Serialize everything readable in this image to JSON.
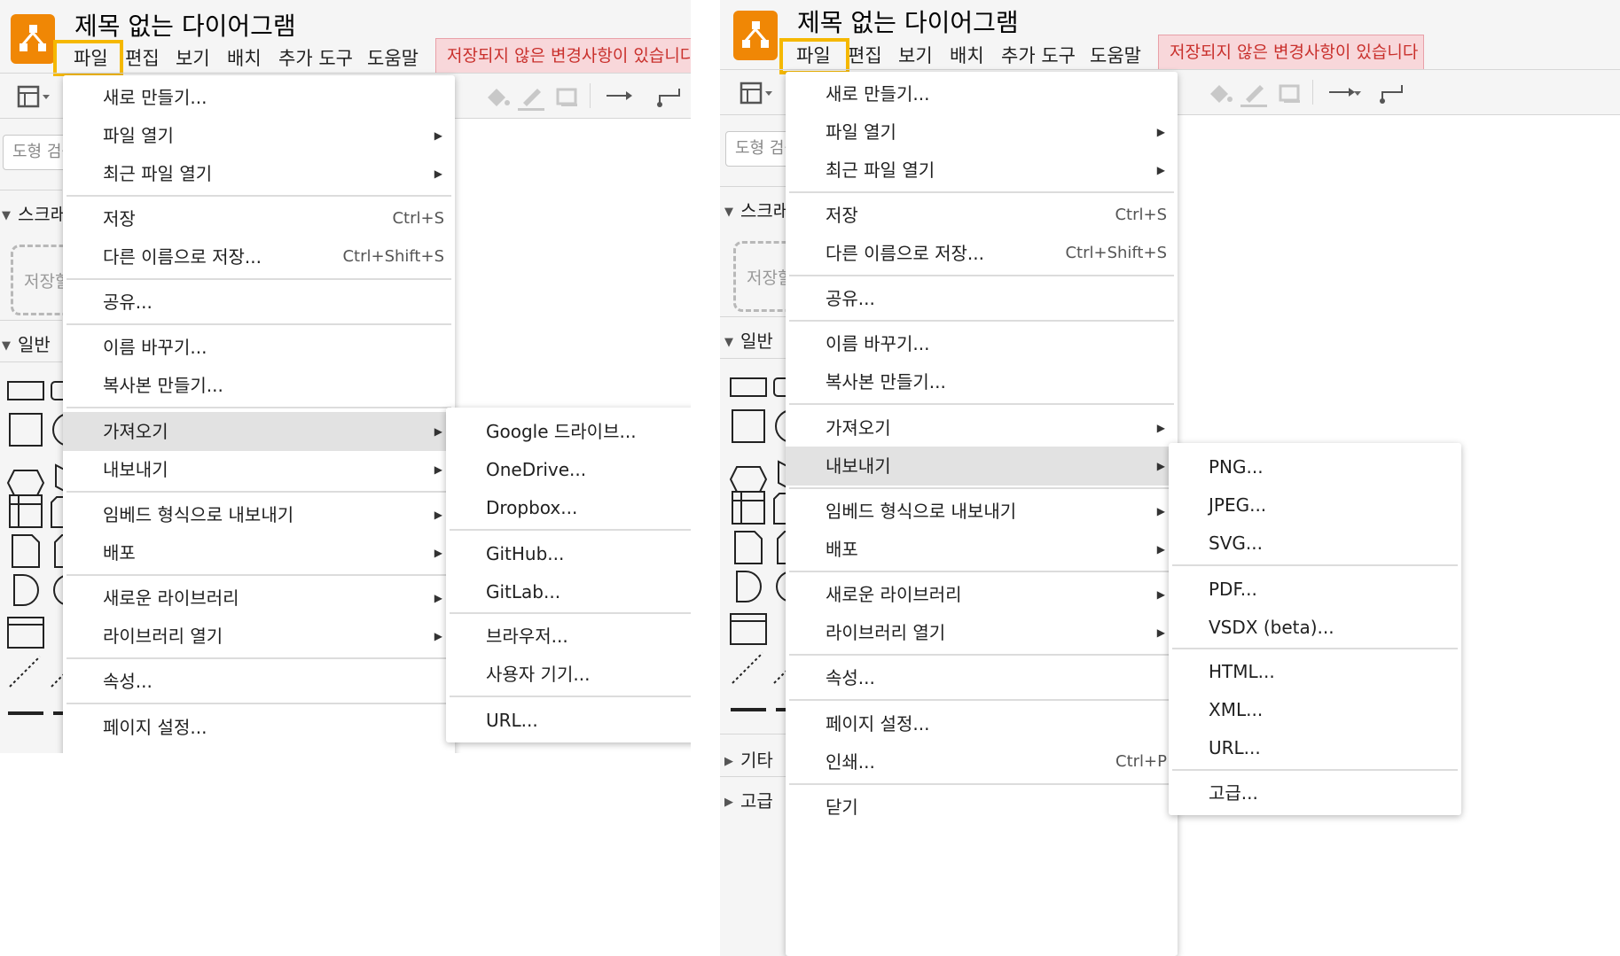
{
  "app": {
    "title": "제목 없는 다이어그램",
    "menubar": [
      "파일",
      "편집",
      "보기",
      "배치",
      "추가 도구",
      "도움말"
    ],
    "unsaved_notice": "저장되지 않은 변경사항이 있습니다. 저",
    "unsaved_notice_right": "저장되지 않은 변경사항이 있습니다",
    "search_placeholder": "도형 검색",
    "sections": {
      "scratchpad": "스크래",
      "general": "일반",
      "other": "기타",
      "advanced": "고급"
    },
    "scratch_hint": "저장할"
  },
  "file_menu": {
    "items": {
      "new": "새로 만들기...",
      "open": "파일 열기",
      "recent": "최근 파일 열기",
      "save": "저장",
      "save_shortcut": "Ctrl+S",
      "save_as": "다른 이름으로 저장...",
      "save_as_shortcut": "Ctrl+Shift+S",
      "share": "공유...",
      "rename": "이름 바꾸기...",
      "duplicate": "복사본 만들기...",
      "import": "가져오기",
      "export": "내보내기",
      "embed": "임베드 형식으로 내보내기",
      "publish": "배포",
      "new_library": "새로운 라이브러리",
      "open_library": "라이브러리 열기",
      "properties": "속성...",
      "page_setup": "페이지 설정...",
      "print": "인쇄...",
      "print_shortcut": "Ctrl+P",
      "close": "닫기"
    }
  },
  "import_submenu": {
    "google_drive": "Google 드라이브...",
    "onedrive": "OneDrive...",
    "dropbox": "Dropbox...",
    "github": "GitHub...",
    "gitlab": "GitLab...",
    "browser": "브라우저...",
    "device": "사용자 기기...",
    "url": "URL..."
  },
  "export_submenu": {
    "png": "PNG...",
    "jpeg": "JPEG...",
    "svg": "SVG...",
    "pdf": "PDF...",
    "vsdx": "VSDX (beta)...",
    "html": "HTML...",
    "xml": "XML...",
    "url": "URL...",
    "advanced": "고급..."
  },
  "colors": {
    "logo": "#f08705",
    "highlight": "#f5b800",
    "unsaved_bg": "#f8d7da",
    "unsaved_text": "#c9302c"
  }
}
